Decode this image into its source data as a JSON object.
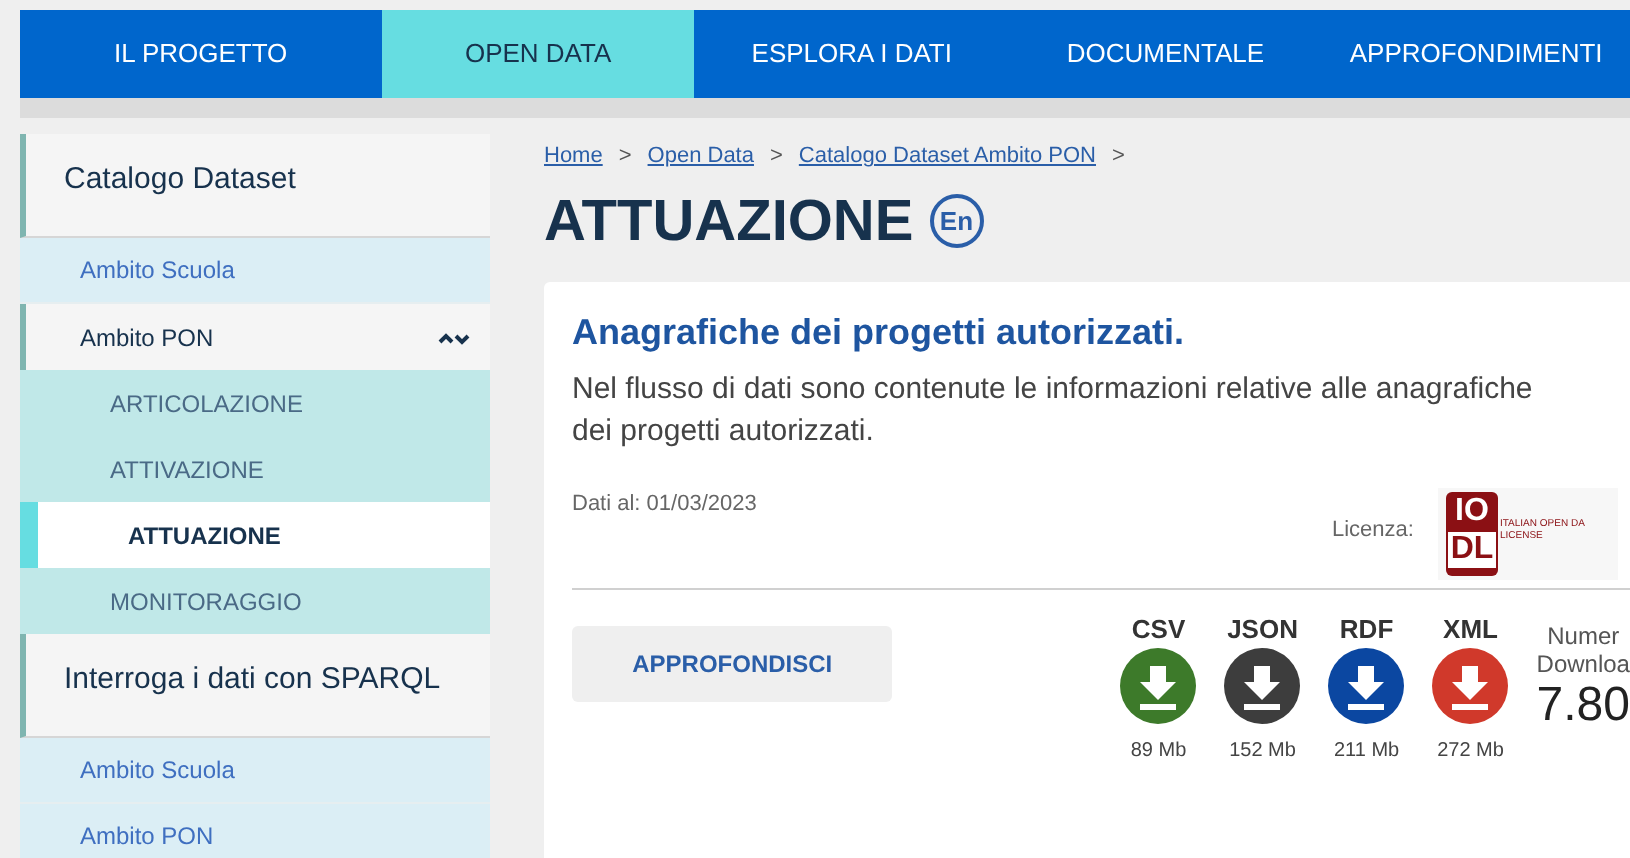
{
  "nav": [
    {
      "label": "IL PROGETTO",
      "selected": false
    },
    {
      "label": "OPEN DATA",
      "selected": true
    },
    {
      "label": "ESPLORA I DATI",
      "selected": false
    },
    {
      "label": "DOCUMENTALE",
      "selected": false
    },
    {
      "label": "APPROFONDIMENTI",
      "selected": false
    }
  ],
  "sidebar": {
    "sections": [
      {
        "title": "Catalogo Dataset",
        "items": [
          {
            "label": "Ambito Scuola",
            "selected": false
          },
          {
            "label": "Ambito PON",
            "expanded": true,
            "children": [
              {
                "label": "ARTICOLAZIONE",
                "selected": false
              },
              {
                "label": "ATTIVAZIONE",
                "selected": false
              },
              {
                "label": "ATTUAZIONE",
                "selected": true
              },
              {
                "label": "MONITORAGGIO",
                "selected": false
              }
            ]
          }
        ]
      },
      {
        "title": "Interroga i dati con SPARQL",
        "items": [
          {
            "label": "Ambito Scuola",
            "selected": false
          },
          {
            "label": "Ambito PON",
            "selected": false
          }
        ]
      }
    ]
  },
  "breadcrumb": [
    "Home",
    "Open Data",
    "Catalogo Dataset Ambito PON"
  ],
  "breadcrumb_separator": ">",
  "page_title": "ATTUAZIONE",
  "language_badge": "En",
  "card": {
    "title": "Anagrafiche dei progetti autorizzati.",
    "description": "Nel flusso di dati sono contenute le informazioni relative alle anagrafiche dei progetti autorizzati.",
    "date": "Dati al: 01/03/2023",
    "license_label": "Licenza:",
    "license_logo": {
      "top": "IO",
      "bottom": "DL",
      "line_1": "ITALIAN OPEN DA",
      "line_2": "LICENSE"
    },
    "button": "APPROFONDISCI",
    "downloads": [
      {
        "format": "CSV",
        "size": "89 Mb",
        "color": "#3d7a2a"
      },
      {
        "format": "JSON",
        "size": "152 Mb",
        "color": "#3d3d3d"
      },
      {
        "format": "RDF",
        "size": "211 Mb",
        "color": "#0b47a1"
      },
      {
        "format": "XML",
        "size": "272 Mb",
        "color": "#d0392b"
      }
    ],
    "download_count": {
      "label_1": "Numer",
      "label_2": "Downloa",
      "value": "7.80"
    }
  }
}
